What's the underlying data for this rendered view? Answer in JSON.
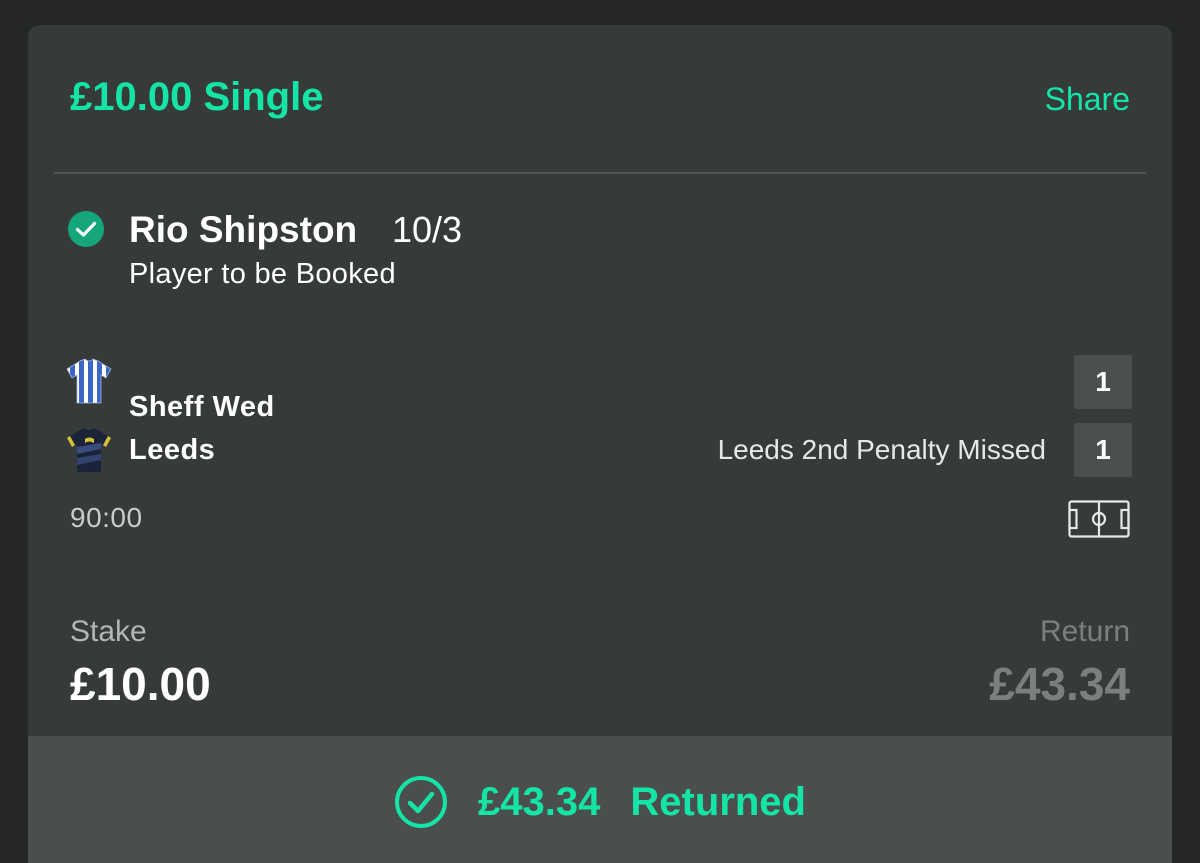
{
  "bet": {
    "title": "£10.00 Single",
    "share_label": "Share"
  },
  "selection": {
    "status_icon": "check-circle-icon",
    "name": "Rio Shipston",
    "odds": "10/3",
    "market": "Player to be Booked"
  },
  "match": {
    "home": {
      "name": "Sheff Wed",
      "score": "1",
      "kit_icon": "sheff-wed-kit-icon"
    },
    "away": {
      "name": "Leeds",
      "score": "1",
      "kit_icon": "leeds-kit-icon",
      "event": "Leeds 2nd Penalty Missed"
    },
    "clock": "90:00",
    "pitch_icon": "pitch-icon"
  },
  "totals": {
    "stake_label": "Stake",
    "stake_value": "£10.00",
    "return_label": "Return",
    "return_value": "£43.34"
  },
  "footer": {
    "amount": "£43.34",
    "label": "Returned"
  },
  "colors": {
    "accent": "#14e5a6",
    "card_bg": "#363b3a",
    "footer_bg": "#4a4f4e",
    "score_bg": "#4a504f",
    "muted_text": "#7b807f"
  }
}
